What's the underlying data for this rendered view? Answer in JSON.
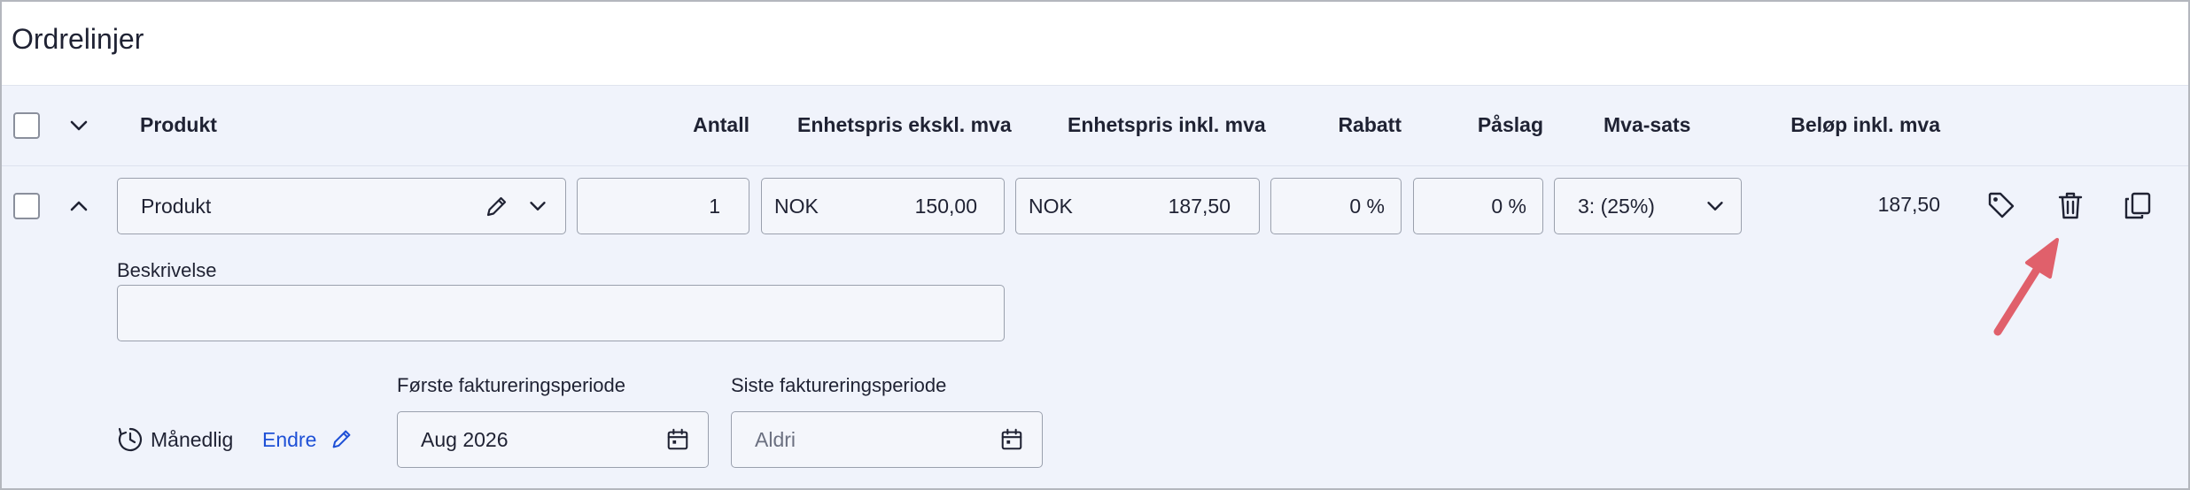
{
  "panel": {
    "title": "Ordrelinjer"
  },
  "header": {
    "product": "Produkt",
    "quantity": "Antall",
    "unit_price_ex": "Enhetspris ekskl. mva",
    "unit_price_inc": "Enhetspris inkl. mva",
    "discount": "Rabatt",
    "markup": "Påslag",
    "vat_rate": "Mva-sats",
    "amount_inc": "Beløp inkl. mva"
  },
  "line": {
    "product_value": "Produkt",
    "quantity": "1",
    "currency_ex": "NOK",
    "unit_price_ex": "150,00",
    "currency_inc": "NOK",
    "unit_price_inc": "187,50",
    "discount": "0 %",
    "markup": "0 %",
    "vat_rate": "3: (25%)",
    "amount_inc": "187,50",
    "description_label": "Beskrivelse",
    "description_value": "",
    "frequency": "Månedlig",
    "change_link": "Endre",
    "first_period_label": "Første faktureringsperiode",
    "first_period_value": "Aug 2026",
    "last_period_label": "Siste faktureringsperiode",
    "last_period_placeholder": "Aldri"
  },
  "colors": {
    "link": "#1e50d6",
    "arrow": "#e0606b",
    "background": "#f0f3fb"
  },
  "icons": [
    "chevron-down-icon",
    "chevron-up-icon",
    "pencil-icon",
    "tag-icon",
    "trash-icon",
    "copy-icon",
    "clock-icon",
    "calendar-icon"
  ]
}
